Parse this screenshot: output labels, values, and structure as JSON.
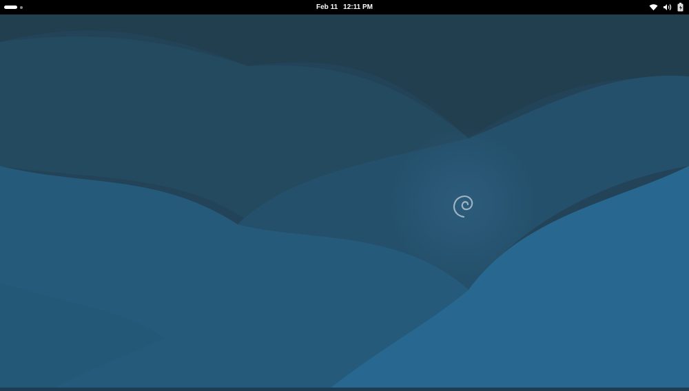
{
  "topbar": {
    "date": "Feb 11",
    "time": "12:11 PM",
    "status_icons": [
      "wifi-icon",
      "volume-icon",
      "battery-icon"
    ],
    "workspaces": {
      "count": 2,
      "active": 1
    }
  },
  "desktop": {
    "wallpaper": "debian-wave",
    "logo_icon": "debian-swirl-icon",
    "colors": {
      "dark": "#223f52",
      "mid": "#24526e",
      "light": "#286890",
      "logo": "#9fb3c2"
    }
  }
}
